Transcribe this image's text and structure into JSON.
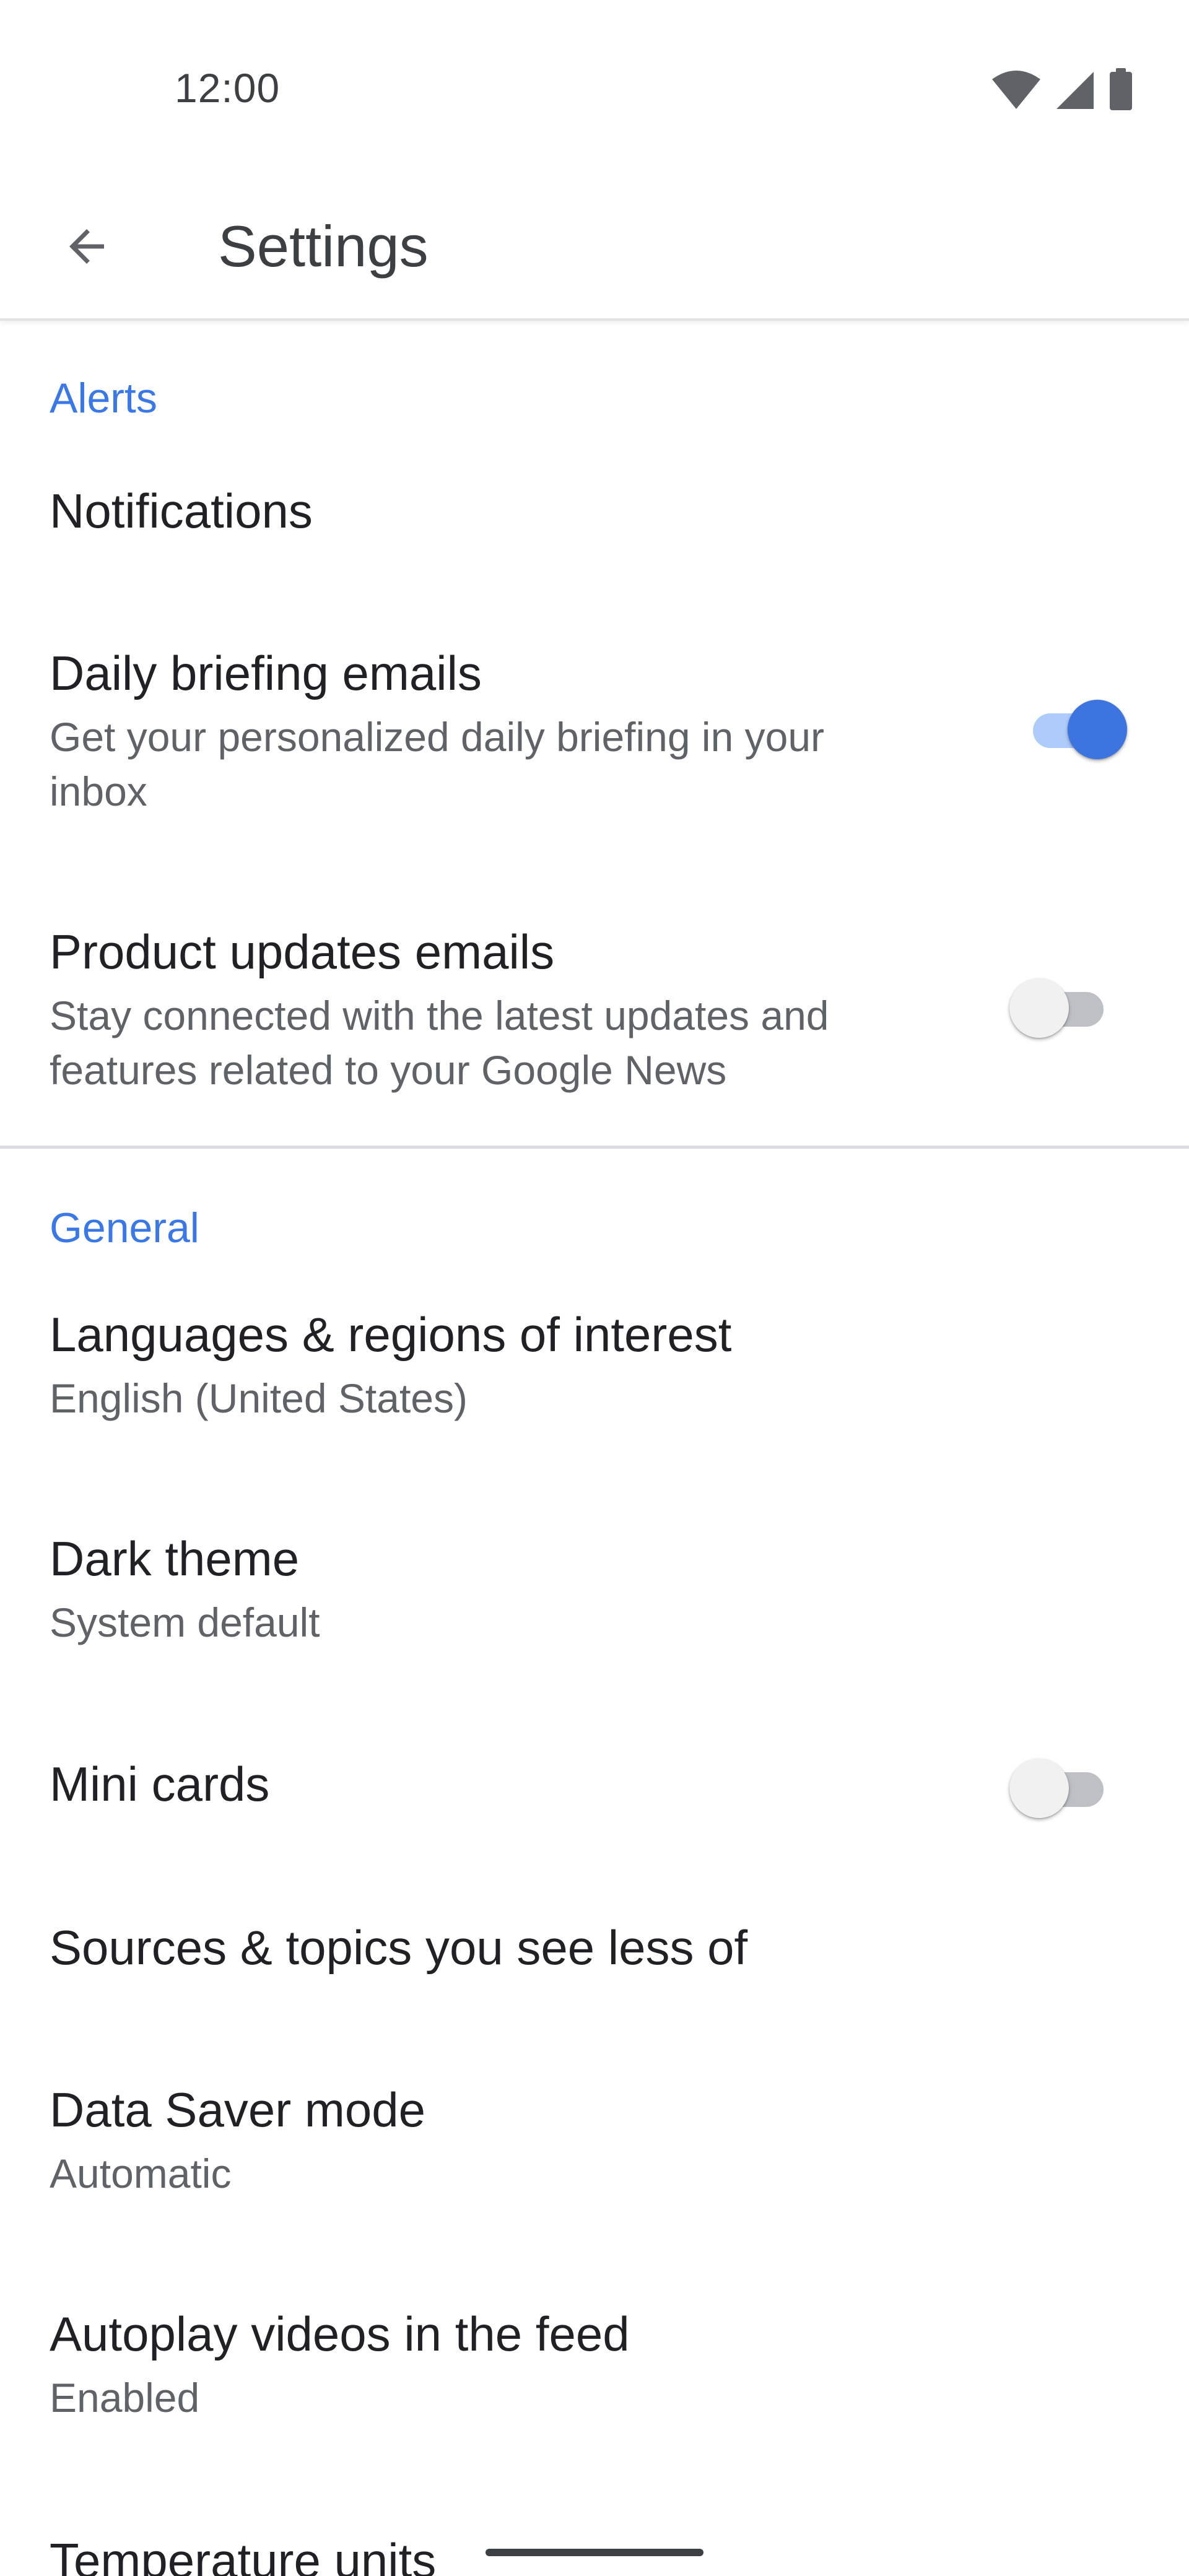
{
  "status_bar": {
    "time": "12:00",
    "icons": [
      "wifi-icon",
      "signal-icon",
      "battery-icon"
    ]
  },
  "app_bar": {
    "back_icon": "arrow-back-icon",
    "title": "Settings"
  },
  "colors": {
    "accent": "#3b78e7",
    "switch_on_thumb": "#3c74e0",
    "switch_on_track": "#aecbfa",
    "text_primary": "#202124",
    "text_secondary": "#5f6368"
  },
  "sections": {
    "alerts": {
      "header": "Alerts",
      "notifications": {
        "title": "Notifications"
      },
      "daily_briefing": {
        "title": "Daily briefing emails",
        "subtitle": "Get your personalized daily briefing in your inbox",
        "enabled": true
      },
      "product_updates": {
        "title": "Product updates emails",
        "subtitle": "Stay connected with the latest updates and features related to your Google News",
        "enabled": false
      }
    },
    "general": {
      "header": "General",
      "languages": {
        "title": "Languages & regions of interest",
        "subtitle": "English (United States)"
      },
      "dark_theme": {
        "title": "Dark theme",
        "subtitle": "System default"
      },
      "mini_cards": {
        "title": "Mini cards",
        "enabled": false
      },
      "sources_topics": {
        "title": "Sources & topics you see less of"
      },
      "data_saver": {
        "title": "Data Saver mode",
        "subtitle": "Automatic"
      },
      "autoplay": {
        "title": "Autoplay videos in the feed",
        "subtitle": "Enabled"
      },
      "temperature": {
        "title": "Temperature units"
      }
    }
  }
}
